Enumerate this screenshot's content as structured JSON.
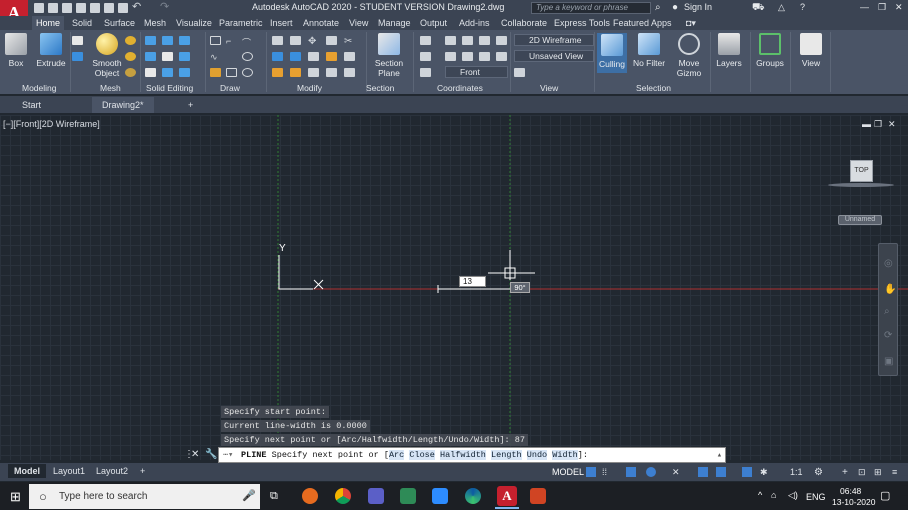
{
  "window": {
    "title": "Autodesk AutoCAD 2020 - STUDENT VERSION    Drawing2.dwg",
    "search_placeholder": "Type a keyword or phrase",
    "sign_in": "Sign In",
    "app_letter": "A"
  },
  "ribbon_tabs": [
    "Home",
    "Solid",
    "Surface",
    "Mesh",
    "Visualize",
    "Parametric",
    "Insert",
    "Annotate",
    "View",
    "Manage",
    "Output",
    "Add-ins",
    "Collaborate",
    "Express Tools",
    "Featured Apps"
  ],
  "ribbon": {
    "box": "Box",
    "extrude": "Extrude",
    "smooth_object_1": "Smooth",
    "smooth_object_2": "Object",
    "section_plane_1": "Section",
    "section_plane_2": "Plane",
    "visual_style": "2D Wireframe",
    "named_view": "Unsaved View",
    "ucs_view": "Front",
    "culling": "Culling",
    "no_filter": "No Filter",
    "move_gizmo_1": "Move",
    "move_gizmo_2": "Gizmo",
    "layers": "Layers",
    "groups": "Groups",
    "view": "View",
    "panels": [
      "Modeling",
      "Mesh",
      "Solid Editing",
      "Draw",
      "Modify",
      "Section",
      "Coordinates",
      "View",
      "Selection"
    ]
  },
  "file_tabs": {
    "start": "Start",
    "drawing": "Drawing2*",
    "add": "+"
  },
  "viewport": {
    "label": "[−][Front][2D Wireframe]",
    "viewcube_face": "TOP",
    "wcs_label": "Unnamed",
    "ucs_y": "Y",
    "dyn_input_value": "13",
    "angle_tooltip": "90°"
  },
  "command": {
    "history": [
      "Specify start point:",
      "Current line-width is 0.0000",
      "Specify next point or [Arc/Halfwidth/Length/Undo/Width]: 87"
    ],
    "current_cmd": "PLINE",
    "prompt": "Specify next point or [",
    "options": [
      "Arc",
      "Close",
      "Halfwidth",
      "Length",
      "Undo",
      "Width"
    ],
    "suffix": "]:"
  },
  "status": {
    "layout_tabs": [
      "Model",
      "Layout1",
      "Layout2"
    ],
    "model_label": "MODEL",
    "scale": "1:1"
  },
  "taskbar": {
    "search_placeholder": "Type here to search",
    "language": "ENG",
    "time": "06:48",
    "date": "13-10-2020"
  },
  "colors": {
    "accent_red": "#c5202e",
    "canvas_bg": "#212830",
    "ribbon_bg": "#4a5466",
    "axis_red": "#b03030",
    "axis_green": "#2e7d32"
  }
}
